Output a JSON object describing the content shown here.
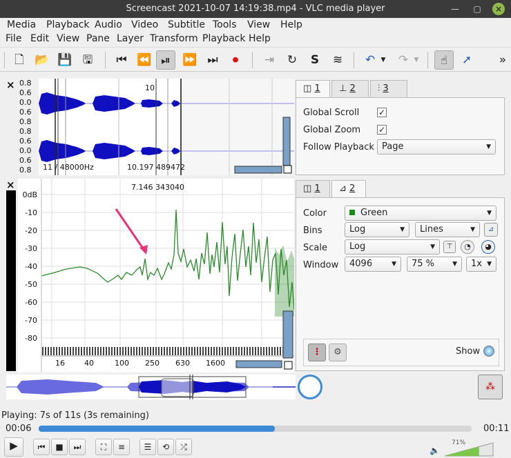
{
  "window": {
    "title": "Screencast 2021-10-07 14:19:38.mp4 - VLC media player",
    "min_icon": "minimize-icon",
    "max_icon": "maximize-icon",
    "close_icon": "close-icon"
  },
  "vlc_menu": [
    "Media",
    "Playback",
    "Audio",
    "Video",
    "Subtitle",
    "Tools",
    "View",
    "Help"
  ],
  "app_menu": [
    "File",
    "Edit",
    "View",
    "Pane",
    "Layer",
    "Transform",
    "Playback",
    "Help"
  ],
  "toolbar_icons": [
    "new-file-icon",
    "open-folder-icon",
    "save-icon",
    "save-as-icon",
    "rewind-start-icon",
    "rewind-icon",
    "play-pause-icon",
    "fast-forward-icon",
    "forward-end-icon",
    "record-icon",
    "play-selection-icon",
    "loop-icon",
    "solo-icon",
    "normalize-icon",
    "undo-icon",
    "redo-icon",
    "navigate-icon",
    "select-icon",
    "more-icon"
  ],
  "waveform_pane": {
    "ticks_top": [
      "0.8",
      "0.6",
      "0.4",
      "0.2",
      "0.0",
      "0.2",
      "0.4",
      "0.6",
      "0.8"
    ],
    "ticks_bot": [
      "0.0",
      "0.2",
      "0.4",
      "0.6",
      "0.8"
    ],
    "marker": "10",
    "bottom_left": "11 / 48000Hz",
    "bottom_right": "10.197  489472"
  },
  "pane1_tabs": [
    "1",
    "2",
    "3"
  ],
  "pane1": {
    "global_scroll": "Global Scroll",
    "global_zoom": "Global Zoom",
    "follow_playback": "Follow Playback",
    "follow_value": "Page",
    "global_scroll_checked": true,
    "global_zoom_checked": true
  },
  "spectrum_pane": {
    "readout": "7.146  343040",
    "db_ticks": [
      "0dB",
      "-10",
      "-20",
      "-30",
      "-40",
      "-50",
      "-60",
      "-70",
      "-80"
    ],
    "freq_ticks": [
      "16",
      "40",
      "100",
      "250",
      "630",
      "1600"
    ]
  },
  "pane2_tabs": [
    "1",
    "2"
  ],
  "pane2": {
    "color_label": "Color",
    "color_value": "Green",
    "color_swatch": "#1a8a1a",
    "bins_label": "Bins",
    "bins_value": "Log",
    "lines_value": "Lines",
    "scale_label": "Scale",
    "scale_value": "Log",
    "window_label": "Window",
    "window_value": "4096",
    "overlap_value": "75 %",
    "zoom_value": "1x",
    "show_label": "Show"
  },
  "status": {
    "playing": "Playing: 7s of 11s (3s remaining)",
    "elapsed": "00:06",
    "total": "00:11",
    "volume": "71%",
    "progress": 0.545
  },
  "colors": {
    "wave": "#1010c0",
    "spectrum": "#2a8a2a",
    "arrow": "#e6337a",
    "progress": "#3d8ad6"
  }
}
